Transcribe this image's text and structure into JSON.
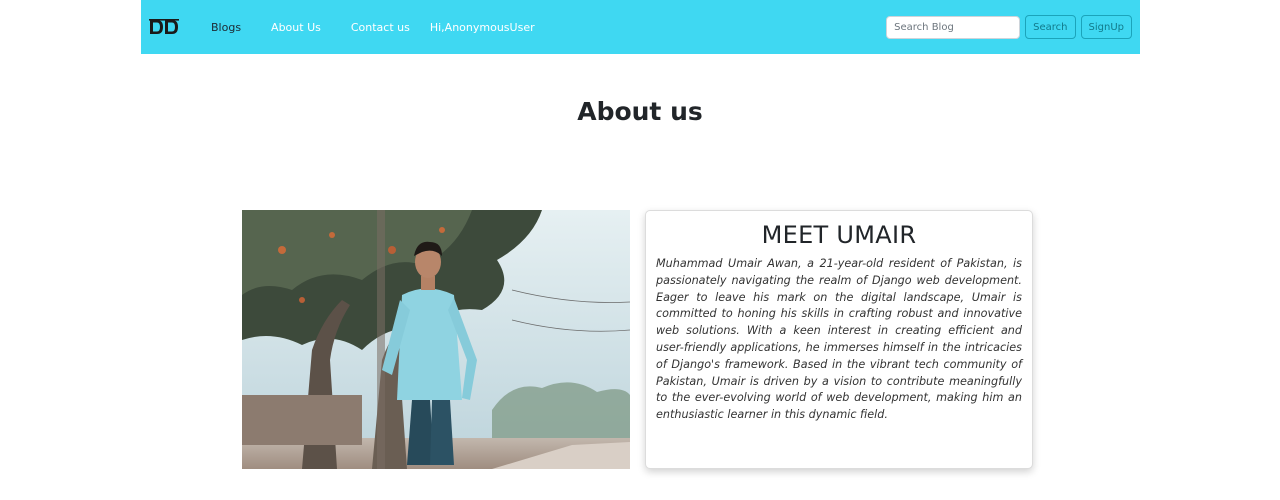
{
  "nav": {
    "brand_logo": "DD",
    "links": [
      "Blogs",
      "About Us",
      "Contact us"
    ],
    "greeting": "Hi,AnonymousUser",
    "search_placeholder": "Search Blog",
    "search_button": "Search",
    "signup_button": "SignUp",
    "bg_color": "#3fd8f2"
  },
  "page": {
    "title": "About us"
  },
  "profile": {
    "photo_icon": "person-photo",
    "card_title": "MEET UMAIR",
    "bio": "Muhammad Umair Awan, a 21-year-old resident of Pakistan, is passionately navigating the realm of Django web development. Eager to leave his mark on the digital landscape, Umair is committed to honing his skills in crafting robust and innovative web solutions. With a keen interest in creating efficient and user-friendly applications, he immerses himself in the intricacies of Django's framework. Based in the vibrant tech community of Pakistan, Umair is driven by a vision to contribute meaningfully to the ever-evolving world of web development, making him an enthusiastic learner in this dynamic field."
  }
}
